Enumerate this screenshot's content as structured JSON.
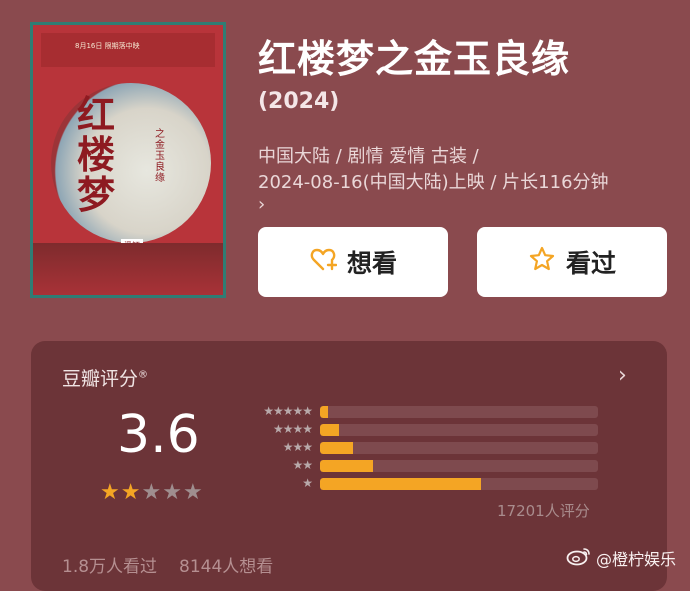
{
  "poster": {
    "top_text": "8月16日  限期落中映",
    "calligraphy": [
      "红",
      "楼",
      "梦"
    ],
    "vertical_text": "之金玉良缘",
    "seal_text": "泽钰"
  },
  "movie": {
    "title": "红楼梦之金玉良缘",
    "year": "(2024)",
    "meta_line1": "中国大陆 / 剧情 爱情 古装 /",
    "meta_line2": "2024-08-16(中国大陆)上映 / 片长116分钟",
    "more_glyph": "›"
  },
  "buttons": {
    "want_label": "想看",
    "seen_label": "看过"
  },
  "rating": {
    "section_title": "豆瓣评分",
    "registered_mark": "®",
    "arrow": "›",
    "score": "3.6",
    "stars_filled": 2,
    "stars_total": 5,
    "distribution": [
      {
        "stars": 5,
        "label": "★★★★★",
        "fraction": 0.03
      },
      {
        "stars": 4,
        "label": "★★★★",
        "fraction": 0.07
      },
      {
        "stars": 3,
        "label": "★★★",
        "fraction": 0.12
      },
      {
        "stars": 2,
        "label": "★★",
        "fraction": 0.19
      },
      {
        "stars": 1,
        "label": "★",
        "fraction": 0.58
      }
    ],
    "ratings_count": "17201人评分",
    "seen_count": "1.8万人看过",
    "want_count": "8144人想看"
  },
  "watermark": {
    "text": "@橙柠娱乐",
    "icon": "weibo-icon"
  },
  "colors": {
    "background": "#8a4a4e",
    "card": "#6c3438",
    "accent": "#f4a524"
  }
}
